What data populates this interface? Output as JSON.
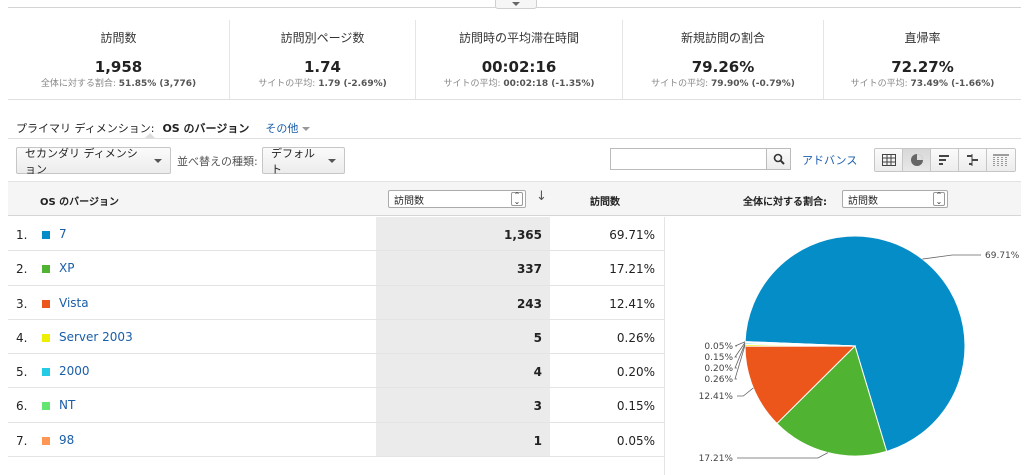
{
  "metrics": [
    {
      "label": "訪問数",
      "value": "1,958",
      "sub_prefix": "全体に対する割合:",
      "sub_value": "51.85% (3,776)"
    },
    {
      "label": "訪問別ページ数",
      "value": "1.74",
      "sub_prefix": "サイトの平均:",
      "sub_value": "1.79 (-2.69%)"
    },
    {
      "label": "訪問時の平均滞在時間",
      "value": "00:02:16",
      "sub_prefix": "サイトの平均:",
      "sub_value": "00:02:18 (-1.35%)"
    },
    {
      "label": "新規訪問の割合",
      "value": "79.26%",
      "sub_prefix": "サイトの平均:",
      "sub_value": "79.90% (-0.79%)"
    },
    {
      "label": "直帰率",
      "value": "72.27%",
      "sub_prefix": "サイトの平均:",
      "sub_value": "73.49% (-1.66%)"
    }
  ],
  "dimension": {
    "prefix": "プライマリ ディメンション:",
    "active": "OS のバージョン",
    "other": "その他"
  },
  "toolbar": {
    "secondary_dimension": "セカンダリ ディメンション",
    "sort_label": "並べ替えの種類:",
    "sort_value": "デフォルト",
    "search_value": "",
    "advanced": "アドバンス",
    "views": [
      "table-view-icon",
      "pie-view-icon",
      "performance-view-icon",
      "comparison-view-icon",
      "pivot-view-icon"
    ]
  },
  "table": {
    "col_dimension": "OS のバージョン",
    "metric_select": "訪問数",
    "col_visits": "訪問数",
    "share_label": "全体に対する割合:",
    "share_select": "訪問数",
    "rows": [
      {
        "index": "1.",
        "name": "7",
        "color": "#058dc7",
        "visits": "1,365",
        "pct": "69.71%"
      },
      {
        "index": "2.",
        "name": "XP",
        "color": "#50b432",
        "visits": "337",
        "pct": "17.21%"
      },
      {
        "index": "3.",
        "name": "Vista",
        "color": "#ed561b",
        "visits": "243",
        "pct": "12.41%"
      },
      {
        "index": "4.",
        "name": "Server 2003",
        "color": "#edef00",
        "visits": "5",
        "pct": "0.26%"
      },
      {
        "index": "5.",
        "name": "2000",
        "color": "#24cbe5",
        "visits": "4",
        "pct": "0.20%"
      },
      {
        "index": "6.",
        "name": "NT",
        "color": "#64e572",
        "visits": "3",
        "pct": "0.15%"
      },
      {
        "index": "7.",
        "name": "98",
        "color": "#ff9655",
        "visits": "1",
        "pct": "0.05%"
      }
    ]
  },
  "chart_data": {
    "type": "pie",
    "labels": [
      "7",
      "XP",
      "Vista",
      "Server 2003",
      "2000",
      "NT",
      "98"
    ],
    "values": [
      69.71,
      17.21,
      12.41,
      0.26,
      0.2,
      0.15,
      0.05
    ],
    "value_labels": [
      "69.71%",
      "17.21%",
      "12.41%",
      "0.26%",
      "0.20%",
      "0.15%",
      "0.05%"
    ],
    "colors": [
      "#058dc7",
      "#50b432",
      "#ed561b",
      "#edef00",
      "#24cbe5",
      "#64e572",
      "#ff9655"
    ]
  }
}
